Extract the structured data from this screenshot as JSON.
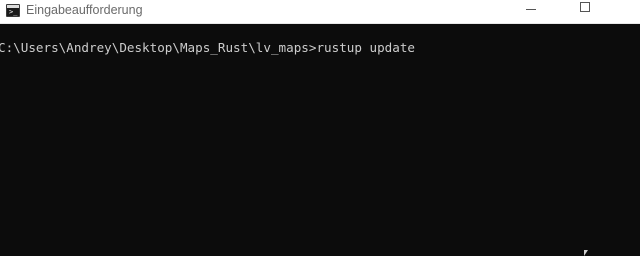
{
  "window": {
    "title": "Eingabeaufforderung",
    "app_icon": "command-prompt-icon",
    "app_icon_glyph": ">_",
    "controls": {
      "minimize_icon": "minimize-icon",
      "maximize_icon": "maximize-icon"
    }
  },
  "console": {
    "line": "C:\\Users\\Andrey\\Desktop\\Maps_Rust\\lv_maps>rustup update",
    "background": "#0c0c0c",
    "foreground": "#cccccc"
  },
  "cursor_icon": "mouse-pointer-icon"
}
